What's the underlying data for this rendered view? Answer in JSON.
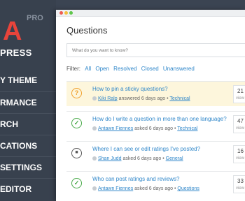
{
  "brand": {
    "logo_letter": "A",
    "pro": "PRO",
    "subtitle": "PRESS"
  },
  "sidebar": {
    "items": [
      {
        "label": "Y THEME"
      },
      {
        "label": "RMANCE"
      },
      {
        "label": "RCH"
      },
      {
        "label": "CATIONS"
      },
      {
        "label": "SETTINGS"
      },
      {
        "label": "EDITOR"
      }
    ]
  },
  "page": {
    "title": "Questions",
    "search_placeholder": "What do you want to know?",
    "filter_label": "Filter:",
    "filters": [
      "All",
      "Open",
      "Resolved",
      "Closed",
      "Unanswered"
    ]
  },
  "questions": [
    {
      "status_icon": "question-icon",
      "title": "How to pin a sticky questions?",
      "user": "Kiki Ralp",
      "action": "answered 6 days ago",
      "category": "Technical",
      "views": "21",
      "views_label": "view"
    },
    {
      "status_icon": "check-icon",
      "title": "How do I write a question in more than one language?",
      "user": "Antawn Fiennes",
      "action": "asked 6 days ago",
      "category": "Technical",
      "views": "47",
      "views_label": "view"
    },
    {
      "status_icon": "lock-icon",
      "title": "Where I can see or edit ratings I've posted?",
      "user": "Shan Judd",
      "action": "asked 6 days ago",
      "category": "General",
      "views": "16",
      "views_label": "view"
    },
    {
      "status_icon": "check-icon",
      "title": "Who can post ratings and reviews?",
      "user": "Antawn Fiennes",
      "action": "asked 6 days ago",
      "category": "Questions",
      "views": "33",
      "views_label": "view"
    }
  ]
}
